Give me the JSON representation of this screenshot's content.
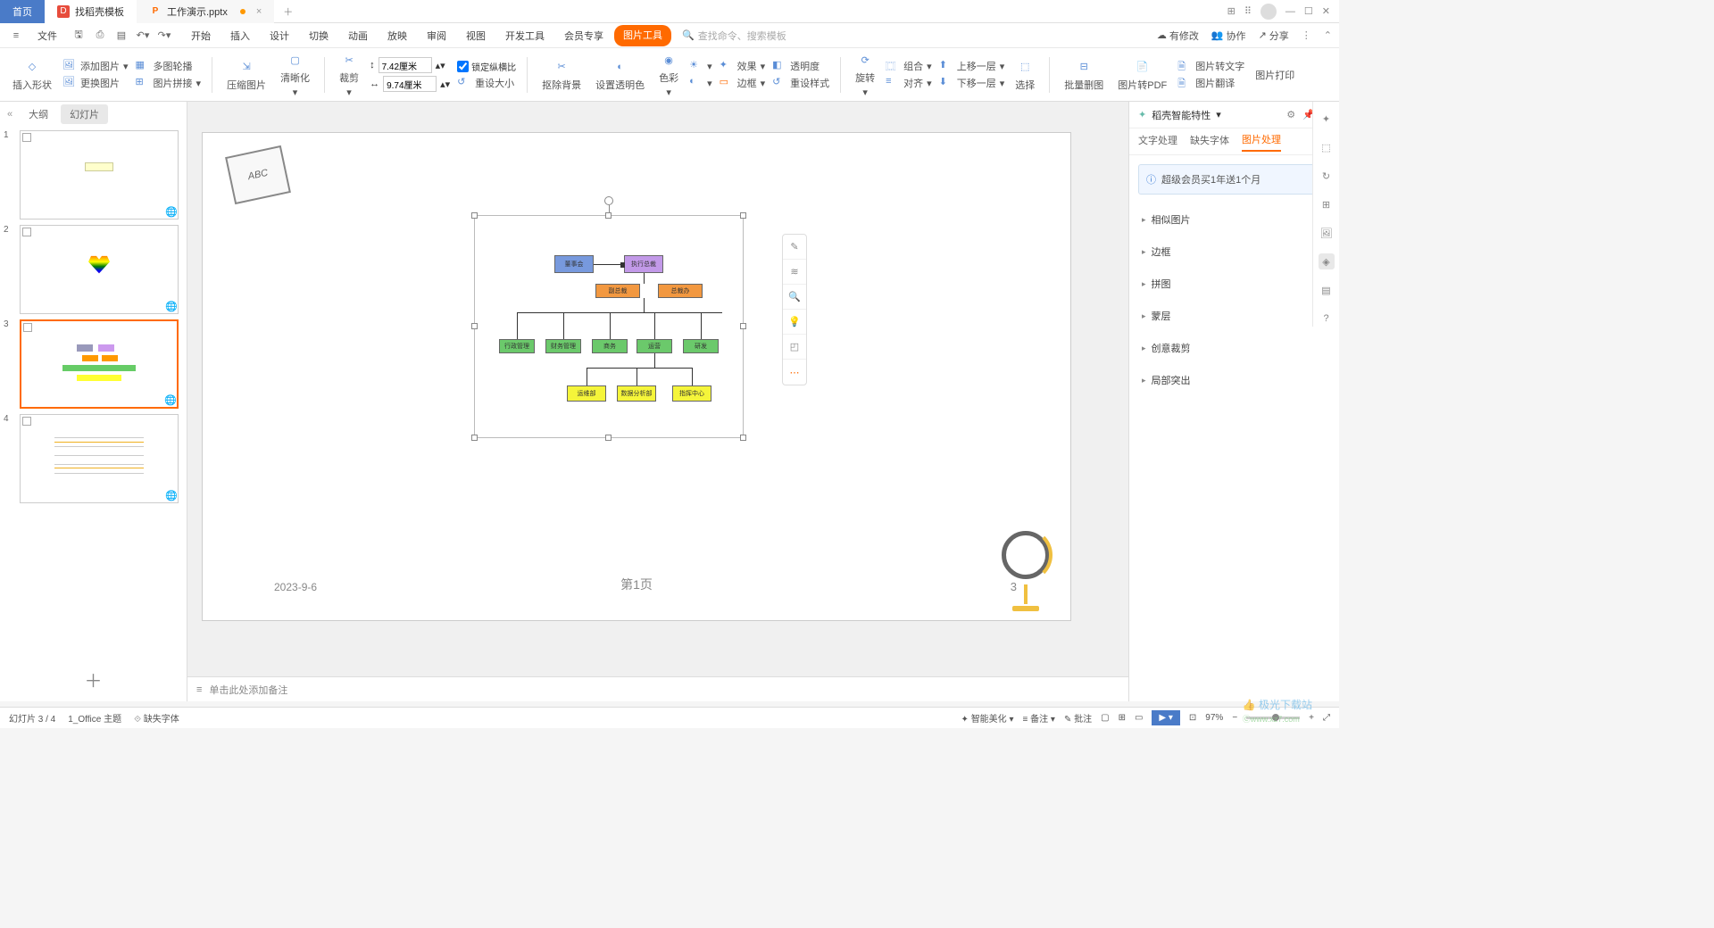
{
  "titlebar": {
    "home": "首页",
    "tab1": "找稻壳模板",
    "tab2": "工作演示.pptx"
  },
  "menubar": {
    "file": "文件",
    "tabs": [
      "开始",
      "插入",
      "设计",
      "切换",
      "动画",
      "放映",
      "审阅",
      "视图",
      "开发工具",
      "会员专享"
    ],
    "pic_tools": "图片工具",
    "search_ph": "查找命令、搜索模板",
    "right": {
      "pending": "有修改",
      "coop": "协作",
      "share": "分享"
    }
  },
  "ribbon": {
    "insert_shape": "插入形状",
    "add_image": "添加图片",
    "change_image": "更换图片",
    "multi_outline": "多图轮播",
    "image_splice": "图片拼接",
    "compress": "压缩图片",
    "clarity": "清晰化",
    "crop": "裁剪",
    "w": "7.42厘米",
    "h": "9.74厘米",
    "lock_ratio": "锁定纵横比",
    "reset_size": "重设大小",
    "remove_bg": "抠除背景",
    "set_trans": "设置透明色",
    "color": "色彩",
    "effect": "效果",
    "trans": "透明度",
    "border": "边框",
    "reset_style": "重设样式",
    "rotate": "旋转",
    "combine": "组合",
    "align": "对齐",
    "up_layer": "上移一层",
    "down_layer": "下移一层",
    "select": "选择",
    "batch": "批量删图",
    "to_pdf": "图片转PDF",
    "to_text": "图片转文字",
    "translate": "图片翻译",
    "print": "图片打印"
  },
  "panel": {
    "outline": "大纲",
    "slides": "幻灯片"
  },
  "slide": {
    "date": "2023-9-6",
    "page": "第1页",
    "num": "3",
    "abc": "ABC",
    "org": {
      "board": "董事会",
      "ceo": "执行总裁",
      "vp": "副总裁",
      "office": "总裁办",
      "admin": "行政管理",
      "finance": "财务管理",
      "biz": "商务",
      "ops": "运营",
      "rd": "研发",
      "opsdept": "运维部",
      "data": "数据分析部",
      "command": "指挥中心"
    }
  },
  "float_tb": [
    "edit",
    "layers",
    "zoom",
    "idea",
    "crop",
    "more"
  ],
  "rightpanel": {
    "title": "稻壳智能特性",
    "tabs": [
      "文字处理",
      "缺失字体",
      "图片处理"
    ],
    "promo": "超级会员买1年送1个月",
    "items": [
      "相似图片",
      "边框",
      "拼图",
      "蒙层",
      "创意裁剪",
      "局部突出"
    ]
  },
  "notes": "单击此处添加备注",
  "statusbar": {
    "slide": "幻灯片 3 / 4",
    "theme": "1_Office 主题",
    "missing_font": "缺失字体",
    "beautify": "智能美化",
    "notes": "备注",
    "comments": "批注",
    "zoom": "97%"
  },
  "watermark": "极光下载站"
}
